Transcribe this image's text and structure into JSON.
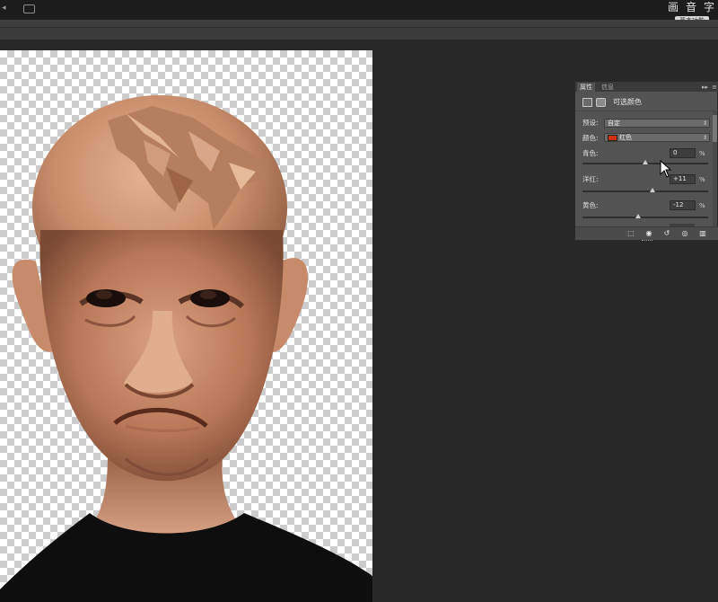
{
  "app": {
    "top_right_glyphs": [
      "画",
      "音",
      "字"
    ],
    "workspace_button": "基本功能"
  },
  "properties_panel": {
    "tabs": [
      "属性",
      "信息"
    ],
    "collapse_glyph": "▸▸",
    "menu_glyph": "≡",
    "title": "可选颜色",
    "preset_label": "预设:",
    "preset_value": "自定",
    "colors_label": "颜色:",
    "colors_value": "红色",
    "colors_swatch": "#d03010",
    "sliders": [
      {
        "label": "青色:",
        "value": "0",
        "unit": "%",
        "level": 0
      },
      {
        "label": "洋红:",
        "value": "+11",
        "unit": "%",
        "level": 11
      },
      {
        "label": "黄色:",
        "value": "-12",
        "unit": "%",
        "level": -12
      }
    ],
    "footer_icons": [
      "clip-to-layer-icon",
      "eye-view-previous-icon",
      "reset-icon",
      "visibility-eye-icon",
      "trash-icon"
    ]
  }
}
